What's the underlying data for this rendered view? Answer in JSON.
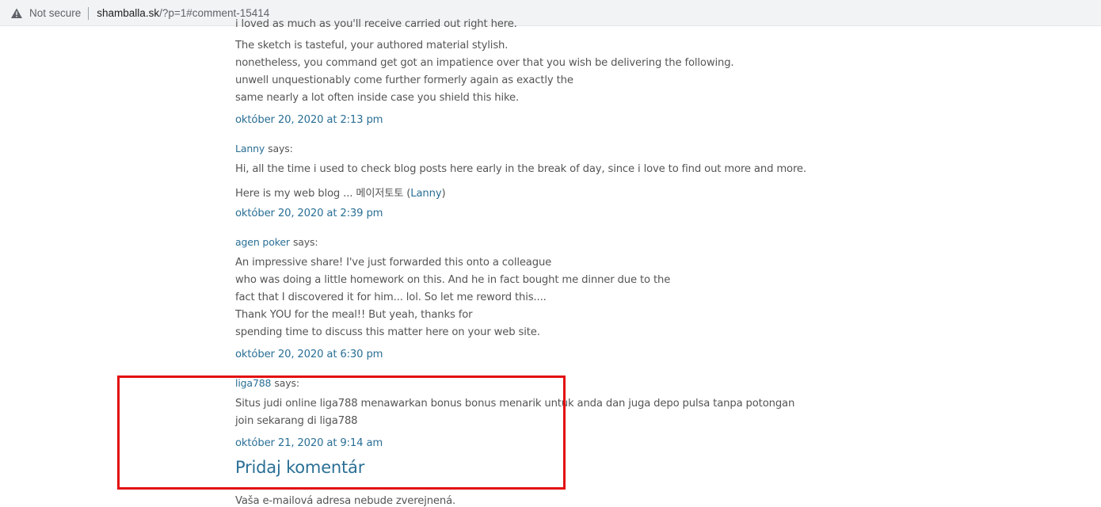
{
  "browser": {
    "security_label": "Not secure",
    "url_host": "shamballa.sk",
    "url_rest": "/?p=1#comment-15414"
  },
  "comments": [
    {
      "lines": [
        "i loved as much as you'll receive carried out right here.",
        "The sketch is tasteful, your authored material stylish.",
        "nonetheless, you command get got an impatience over that you wish be delivering the following.",
        "unwell unquestionably come further formerly again as exactly the",
        "same nearly a lot often inside case you shield this hike."
      ],
      "date": "október 20, 2020 at 2:13 pm"
    },
    {
      "author": "Lanny",
      "says": "says:",
      "lines": [
        "Hi, all the time i used to check blog posts here early in the break of day, since i love to find out more and more."
      ],
      "blog_prefix": "Here is my web blog ... 메이저토토 (",
      "blog_link": "Lanny",
      "blog_suffix": ")",
      "date": "október 20, 2020 at 2:39 pm"
    },
    {
      "author": "agen poker",
      "says": "says:",
      "lines": [
        "An impressive share! I've just forwarded this onto a colleague",
        "who was doing a little homework on this. And he in fact bought me dinner due to the",
        "fact that I discovered it for him... lol. So let me reword this....",
        "Thank YOU for the meal!! But yeah, thanks for",
        "spending time to discuss this matter here on your web site."
      ],
      "date": "október 20, 2020 at 6:30 pm"
    },
    {
      "author": "liga788",
      "says": "says:",
      "lines": [
        "Situs judi online liga788 menawarkan bonus bonus menarik untuk anda dan juga depo pulsa tanpa potongan",
        "join sekarang di liga788"
      ],
      "date": "október 21, 2020 at 9:14 am"
    }
  ],
  "reply": {
    "heading": "Pridaj komentár",
    "note": "Vaša e-mailová adresa nebude zverejnená."
  },
  "colors": {
    "link": "#2a6f95",
    "text": "#555555",
    "highlight": "#e30f0f"
  }
}
